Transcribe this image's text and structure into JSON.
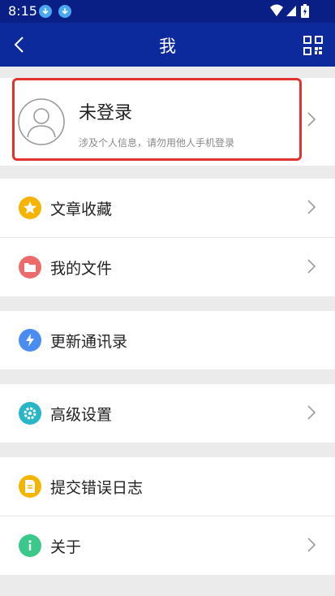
{
  "status_bar": {
    "time": "8:15",
    "icons": [
      "download-icon",
      "download-icon",
      "wifi-icon",
      "cellular-signal-icon",
      "battery-charging-icon"
    ]
  },
  "header": {
    "title": "我",
    "back_icon": "chevron-left-icon",
    "action_icon": "qr-code-icon"
  },
  "profile": {
    "title": "未登录",
    "subtitle": "涉及个人信息，请勿用他人手机登录",
    "avatar_icon": "user-icon"
  },
  "menu_groups": [
    [
      {
        "label": "文章收藏",
        "icon": "star-icon",
        "color": "#f5b400"
      },
      {
        "label": "我的文件",
        "icon": "folder-icon",
        "color": "#ee6b6b"
      }
    ],
    [
      {
        "label": "更新通讯录",
        "icon": "refresh-icon",
        "color": "#4a8df0"
      }
    ],
    [
      {
        "label": "高级设置",
        "icon": "gear-icon",
        "color": "#27b5c8"
      }
    ],
    [
      {
        "label": "提交错误日志",
        "icon": "document-icon",
        "color": "#f5b400"
      },
      {
        "label": "关于",
        "icon": "info-icon",
        "color": "#3cc88a"
      }
    ]
  ],
  "colors": {
    "header_bg": "#0d2a9c",
    "highlight_border": "#e2322f"
  }
}
